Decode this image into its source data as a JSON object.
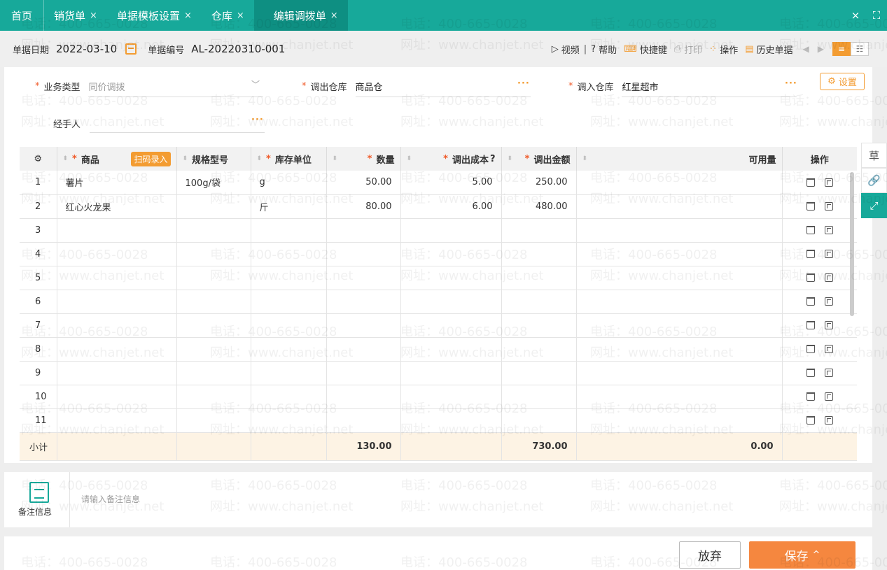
{
  "tabs": {
    "home": "首页",
    "items": [
      {
        "label": "销货单"
      },
      {
        "label": "单据模板设置"
      },
      {
        "label": "仓库"
      },
      {
        "label": "编辑调拨单"
      }
    ],
    "close_glyph": "×"
  },
  "header": {
    "date_label": "单据日期",
    "date_value": "2022-03-10",
    "number_label": "单据编号",
    "number_value": "AL-20220310-001",
    "actions": {
      "video": "视频",
      "help": "帮助",
      "shortcut": "快捷键",
      "print": "打印",
      "operate": "操作",
      "history": "历史单据"
    }
  },
  "form": {
    "business_type_label": "业务类型",
    "business_type_placeholder": "同价调拨",
    "out_warehouse_label": "调出仓库",
    "out_warehouse_value": "商品仓",
    "in_warehouse_label": "调入仓库",
    "in_warehouse_value": "红星超市",
    "handler_label": "经手人",
    "settings_label": "设置",
    "dots": "···"
  },
  "table": {
    "headers": {
      "product": "商品",
      "scan": "扫码录入",
      "spec": "规格型号",
      "unit": "库存单位",
      "qty": "数量",
      "cost": "调出成本",
      "amount": "调出金额",
      "available": "可用量",
      "ops": "操作"
    },
    "rows": [
      {
        "idx": "1",
        "product": "薯片",
        "spec": "100g/袋",
        "unit": "g",
        "qty": "50.00",
        "cost": "5.00",
        "amount": "250.00",
        "available": ""
      },
      {
        "idx": "2",
        "product": "红心火龙果",
        "spec": "",
        "unit": "斤",
        "qty": "80.00",
        "cost": "6.00",
        "amount": "480.00",
        "available": ""
      },
      {
        "idx": "3",
        "product": "",
        "spec": "",
        "unit": "",
        "qty": "",
        "cost": "",
        "amount": "",
        "available": ""
      },
      {
        "idx": "4",
        "product": "",
        "spec": "",
        "unit": "",
        "qty": "",
        "cost": "",
        "amount": "",
        "available": ""
      },
      {
        "idx": "5",
        "product": "",
        "spec": "",
        "unit": "",
        "qty": "",
        "cost": "",
        "amount": "",
        "available": ""
      },
      {
        "idx": "6",
        "product": "",
        "spec": "",
        "unit": "",
        "qty": "",
        "cost": "",
        "amount": "",
        "available": ""
      },
      {
        "idx": "7",
        "product": "",
        "spec": "",
        "unit": "",
        "qty": "",
        "cost": "",
        "amount": "",
        "available": ""
      },
      {
        "idx": "8",
        "product": "",
        "spec": "",
        "unit": "",
        "qty": "",
        "cost": "",
        "amount": "",
        "available": ""
      },
      {
        "idx": "9",
        "product": "",
        "spec": "",
        "unit": "",
        "qty": "",
        "cost": "",
        "amount": "",
        "available": ""
      },
      {
        "idx": "10",
        "product": "",
        "spec": "",
        "unit": "",
        "qty": "",
        "cost": "",
        "amount": "",
        "available": ""
      },
      {
        "idx": "11",
        "product": "",
        "spec": "",
        "unit": "",
        "qty": "",
        "cost": "",
        "amount": "",
        "available": ""
      }
    ],
    "subtotal": {
      "label": "小计",
      "qty": "130.00",
      "amount": "730.00",
      "available": "0.00"
    }
  },
  "sidebar": {
    "draft_icon_text": "草"
  },
  "remarks": {
    "label": "备注信息",
    "placeholder": "请输入备注信息"
  },
  "footer": {
    "cancel": "放弃",
    "save": "保存"
  },
  "watermark": {
    "phone": "电话：400-665-0028",
    "site": "网址：www.chanjet.net"
  },
  "colors": {
    "teal": "#17a99a",
    "orange": "#f39c32",
    "required": "#f05b2a",
    "save": "#f5873f"
  }
}
